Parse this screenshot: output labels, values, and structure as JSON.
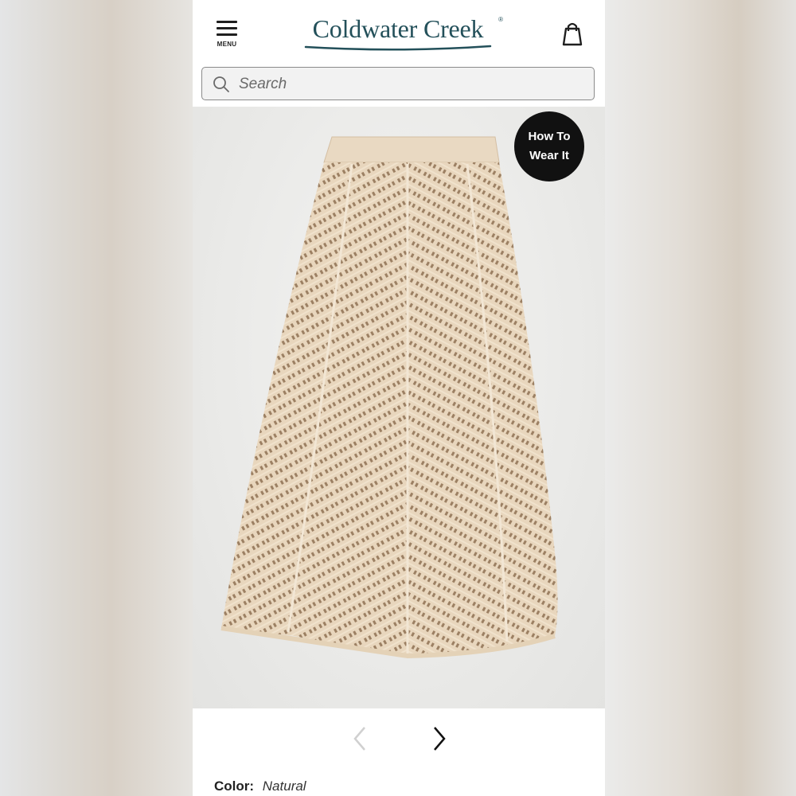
{
  "header": {
    "menu_label": "MENU",
    "logo_text": "Coldwater Creek",
    "logo_mark": "®",
    "brand_color": "#23505a"
  },
  "search": {
    "placeholder": "Search"
  },
  "product": {
    "badge_line1": "How To",
    "badge_line2": "Wear It",
    "color_label": "Color:",
    "color_value": "Natural"
  },
  "icons": {
    "menu": "hamburger-icon",
    "bag": "shopping-bag-icon",
    "search": "search-icon",
    "prev": "chevron-left-icon",
    "next": "chevron-right-icon"
  }
}
